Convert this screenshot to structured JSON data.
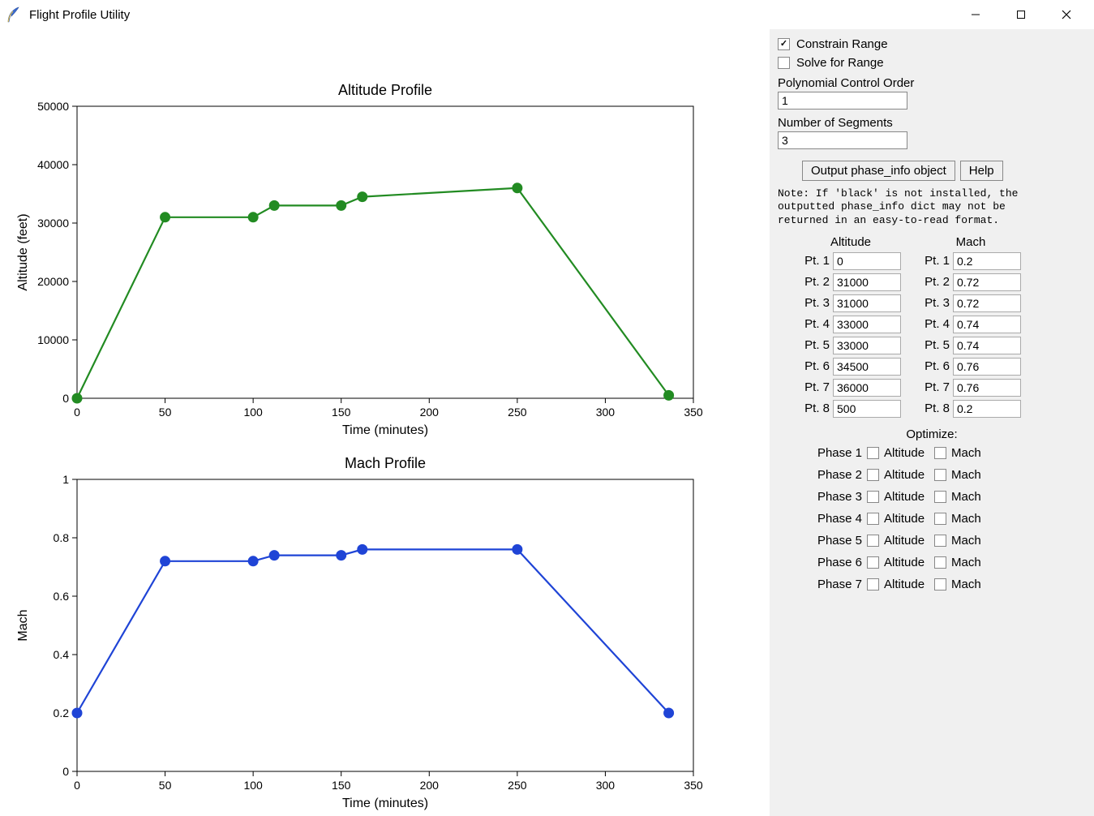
{
  "window": {
    "title": "Flight Profile Utility"
  },
  "side": {
    "constrain_range_label": "Constrain Range",
    "constrain_range_checked": true,
    "solve_range_label": "Solve for Range",
    "solve_range_checked": false,
    "poly_label": "Polynomial Control Order",
    "poly_value": "1",
    "numseg_label": "Number of Segments",
    "numseg_value": "3",
    "output_btn": "Output phase_info object",
    "help_btn": "Help",
    "note": "Note: If 'black' is not installed, the\noutputted phase_info dict may not be\nreturned in an easy-to-read format.",
    "alt_header": "Altitude",
    "mach_header": "Mach",
    "optimize_header": "Optimize:",
    "points": {
      "pt_label_prefix": "Pt. ",
      "altitude": [
        "0",
        "31000",
        "31000",
        "33000",
        "33000",
        "34500",
        "36000",
        "500"
      ],
      "mach": [
        "0.2",
        "0.72",
        "0.72",
        "0.74",
        "0.74",
        "0.76",
        "0.76",
        "0.2"
      ]
    },
    "phases": {
      "phase_label_prefix": "Phase ",
      "count": 7,
      "opt_alt_label": "Altitude",
      "opt_mach_label": "Mach"
    }
  },
  "chart_data": [
    {
      "type": "line",
      "title": "Altitude Profile",
      "xlabel": "Time (minutes)",
      "ylabel": "Altitude (feet)",
      "xlim": [
        0,
        350
      ],
      "ylim": [
        0,
        50000
      ],
      "xticks": [
        0,
        50,
        100,
        150,
        200,
        250,
        300,
        350
      ],
      "yticks": [
        0,
        10000,
        20000,
        30000,
        40000,
        50000
      ],
      "color": "#228b22",
      "x": [
        0,
        50,
        100,
        112,
        150,
        162,
        250,
        336
      ],
      "y": [
        0,
        31000,
        31000,
        33000,
        33000,
        34500,
        36000,
        500
      ]
    },
    {
      "type": "line",
      "title": "Mach Profile",
      "xlabel": "Time (minutes)",
      "ylabel": "Mach",
      "xlim": [
        0,
        350
      ],
      "ylim": [
        0.0,
        1.0
      ],
      "xticks": [
        0,
        50,
        100,
        150,
        200,
        250,
        300,
        350
      ],
      "yticks": [
        0.0,
        0.2,
        0.4,
        0.6,
        0.8,
        1.0
      ],
      "color": "#1f44d6",
      "x": [
        0,
        50,
        100,
        112,
        150,
        162,
        250,
        336
      ],
      "y": [
        0.2,
        0.72,
        0.72,
        0.74,
        0.74,
        0.76,
        0.76,
        0.2
      ]
    }
  ]
}
